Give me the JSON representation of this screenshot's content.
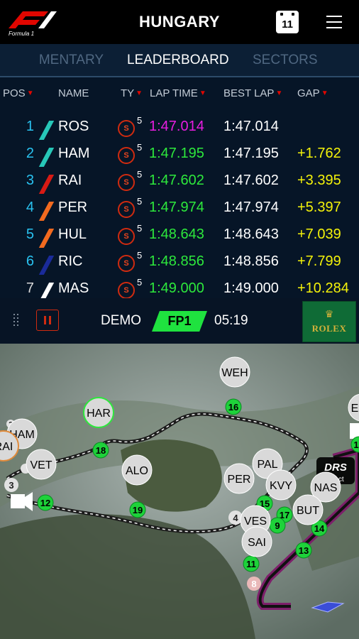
{
  "header": {
    "title": "HUNGARY",
    "calendar_day": "11",
    "logo_text": "Formula 1",
    "logo_icon": "f1-logo-icon",
    "menu_icon": "hamburger-menu-icon"
  },
  "tabs": [
    "COMMENTARY",
    "LEADERBOARD",
    "SECTORS"
  ],
  "tabs_visible": {
    "left": "MENTARY",
    "active": "LEADERBOARD",
    "right": "SECTORS"
  },
  "columns": [
    "POS",
    "NAME",
    "TY",
    "LAP TIME",
    "BEST LAP",
    "GAP"
  ],
  "rows": [
    {
      "pos": "1",
      "name": "ROS",
      "team_color": "#27c7b8",
      "tyre": "S",
      "tyre_laps": "5",
      "lap_time": "1:47.014",
      "lap_color": "#e81ee0",
      "best_lap": "1:47.014",
      "gap": ""
    },
    {
      "pos": "2",
      "name": "HAM",
      "team_color": "#27c7b8",
      "tyre": "S",
      "tyre_laps": "5",
      "lap_time": "1:47.195",
      "lap_color": "#2de83c",
      "best_lap": "1:47.195",
      "gap": "+1.762"
    },
    {
      "pos": "3",
      "name": "RAI",
      "team_color": "#d71a14",
      "tyre": "S",
      "tyre_laps": "5",
      "lap_time": "1:47.602",
      "lap_color": "#2de83c",
      "best_lap": "1:47.602",
      "gap": "+3.395"
    },
    {
      "pos": "4",
      "name": "PER",
      "team_color": "#f26a1f",
      "tyre": "S",
      "tyre_laps": "5",
      "lap_time": "1:47.974",
      "lap_color": "#2de83c",
      "best_lap": "1:47.974",
      "gap": "+5.397"
    },
    {
      "pos": "5",
      "name": "HUL",
      "team_color": "#f26a1f",
      "tyre": "S",
      "tyre_laps": "5",
      "lap_time": "1:48.643",
      "lap_color": "#2de83c",
      "best_lap": "1:48.643",
      "gap": "+7.039"
    },
    {
      "pos": "6",
      "name": "RIC",
      "team_color": "#1a2b9a",
      "tyre": "S",
      "tyre_laps": "5",
      "lap_time": "1:48.856",
      "lap_color": "#2de83c",
      "best_lap": "1:48.856",
      "gap": "+7.799"
    },
    {
      "pos": "7",
      "name": "MAS",
      "team_color": "#ffffff",
      "tyre": "S",
      "tyre_laps": "5",
      "lap_time": "1:49.000",
      "lap_color": "#2de83c",
      "best_lap": "1:49.000",
      "gap": "+10.284"
    }
  ],
  "controls": {
    "mode": "DEMO",
    "session": "FP1",
    "clock": "05:19",
    "sponsor": "ROLEX",
    "pause_icon": "pause-icon",
    "grip_icon": "drag-handle-icon"
  },
  "map": {
    "drs_label": "DRS",
    "drs_sub": "ect",
    "drivers": [
      "WEH",
      "HAR",
      "HAM",
      "RAI",
      "VET",
      "ALO",
      "PER",
      "PAL",
      "KVY",
      "NAS",
      "BUT",
      "VES",
      "SAI",
      "E"
    ],
    "turns": [
      "1",
      "11",
      "12",
      "13",
      "14",
      "15",
      "16",
      "17",
      "18",
      "19",
      "9"
    ],
    "other_numbers": [
      "2",
      "3",
      "4",
      "8"
    ]
  }
}
